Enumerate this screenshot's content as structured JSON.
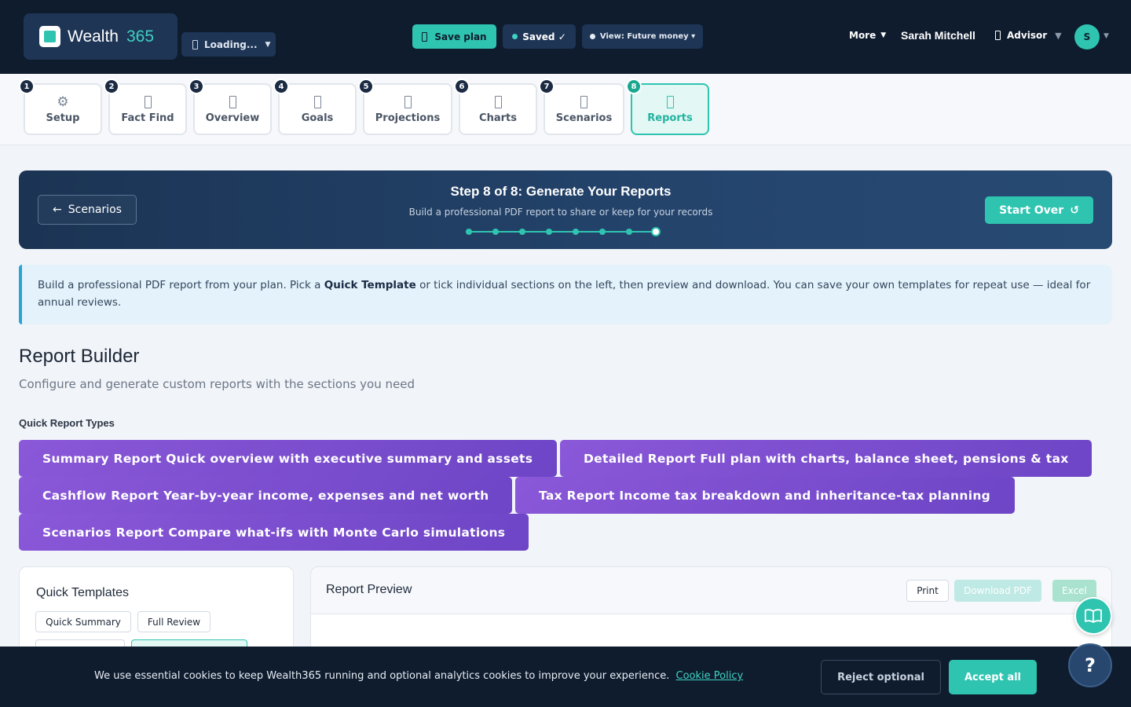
{
  "header": {
    "brand_name": "Wealth",
    "brand_number": "365",
    "loading_label": "Loading...",
    "save_label": "Save plan",
    "saved_label": "Saved ✓",
    "view_label": "View: Future money ▾",
    "more_label": "More",
    "user_name": "Sarah Mitchell",
    "role_label": "Advisor",
    "avatar_initial": "S"
  },
  "steps": [
    {
      "number": "1",
      "label": "Setup",
      "icon": "gear-icon"
    },
    {
      "number": "2",
      "label": "Fact Find",
      "icon": "fact-find-icon"
    },
    {
      "number": "3",
      "label": "Overview",
      "icon": "overview-icon"
    },
    {
      "number": "4",
      "label": "Goals",
      "icon": "goals-icon"
    },
    {
      "number": "5",
      "label": "Projections",
      "icon": "projections-icon"
    },
    {
      "number": "6",
      "label": "Charts",
      "icon": "charts-icon"
    },
    {
      "number": "7",
      "label": "Scenarios",
      "icon": "scenarios-icon"
    },
    {
      "number": "8",
      "label": "Reports",
      "icon": "reports-icon",
      "active": true
    }
  ],
  "banner": {
    "back_label": "Scenarios",
    "title": "Step 8 of 8: Generate Your Reports",
    "subtitle": "Build a professional PDF report to share or keep for your records",
    "start_over_label": "Start Over",
    "current_step": 8,
    "total_steps": 8
  },
  "info": {
    "text_before": "Build a professional PDF report from your plan. Pick a ",
    "bold": "Quick Template",
    "text_after": " or tick individual sections on the left, then preview and download. You can save your own templates for repeat use — ideal for annual reviews."
  },
  "report_builder": {
    "title": "Report Builder",
    "subtitle": "Configure and generate custom reports with the sections you need",
    "quick_types_label": "Quick Report Types",
    "report_types": [
      "Summary Report Quick overview with executive summary and assets",
      "Detailed Report Full plan with charts, balance sheet, pensions & tax",
      "Cashflow Report Year-by-year income, expenses and net worth",
      "Tax Report Income tax breakdown and inheritance-tax planning",
      "Scenarios Report Compare what-ifs with Monte Carlo simulations"
    ]
  },
  "templates": {
    "title": "Quick Templates",
    "items": [
      "Quick Summary",
      "Full Review"
    ]
  },
  "preview": {
    "title": "Report Preview",
    "print_label": "Print",
    "download_pdf_label": "Download PDF",
    "excel_label": "Excel"
  },
  "help": {
    "help_label": "?"
  },
  "cookie": {
    "text": "We use essential cookies to keep Wealth365 running and optional analytics cookies to improve your experience.",
    "link_label": "Cookie Policy",
    "reject_label": "Reject optional",
    "accept_label": "Accept all"
  },
  "colors": {
    "navy": "#0f1c2e",
    "teal": "#2ec4b0",
    "purple": "#7c4fd2",
    "info_blue": "#2aa3d6"
  }
}
